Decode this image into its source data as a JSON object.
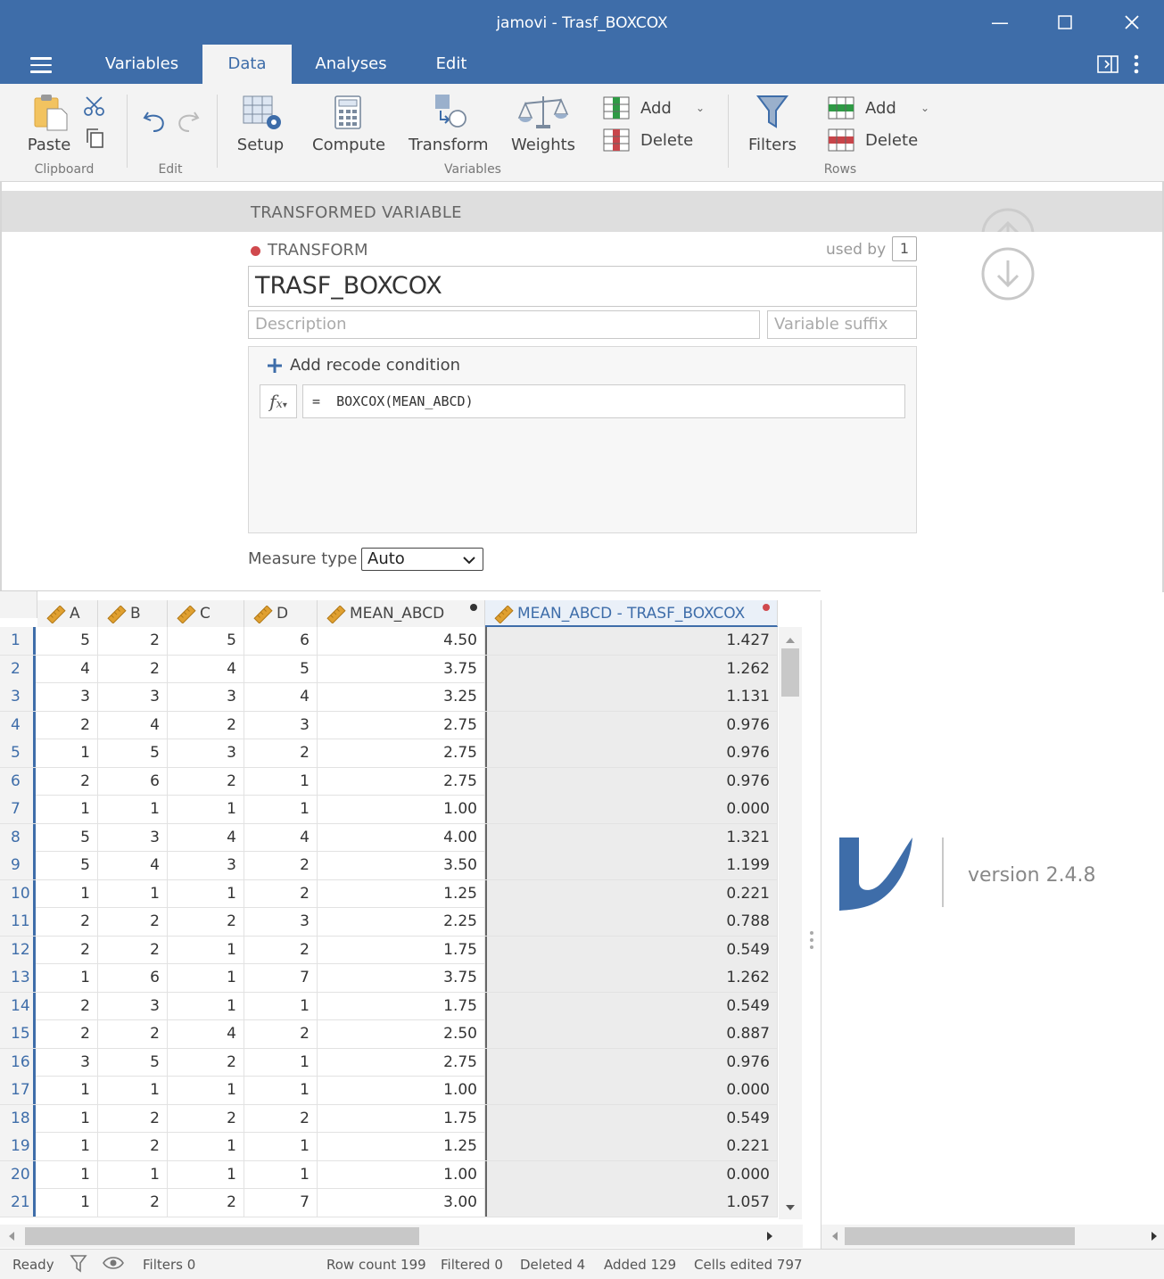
{
  "window": {
    "title": "jamovi - Trasf_BOXCOX"
  },
  "tabs": [
    {
      "label": "Variables"
    },
    {
      "label": "Data"
    },
    {
      "label": "Analyses"
    },
    {
      "label": "Edit"
    }
  ],
  "ribbon": {
    "paste": "Paste",
    "clipboard_group": "Clipboard",
    "edit_group": "Edit",
    "setup": "Setup",
    "compute": "Compute",
    "transform": "Transform",
    "weights": "Weights",
    "var_add": "Add",
    "var_delete": "Delete",
    "variables_group": "Variables",
    "filters": "Filters",
    "row_add": "Add",
    "row_delete": "Delete",
    "rows_group": "Rows"
  },
  "setup": {
    "header": "TRANSFORMED VARIABLE",
    "transform_label": "TRANSFORM",
    "used_by_label": "used by",
    "used_by_count": "1",
    "name": "TRASF_BOXCOX",
    "description_placeholder": "Description",
    "suffix_placeholder": "Variable suffix",
    "add_recode": "Add recode condition",
    "formula": "=  BOXCOX(MEAN_ABCD)",
    "measure_type_label": "Measure type",
    "measure_type_value": "Auto",
    "measure_type_options": [
      "Auto"
    ]
  },
  "grid": {
    "columns": [
      "A",
      "B",
      "C",
      "D",
      "MEAN_ABCD",
      "MEAN_ABCD - TRASF_BOXCOX"
    ],
    "rows": [
      [
        "1",
        "5",
        "2",
        "5",
        "6",
        "4.50",
        "1.427"
      ],
      [
        "2",
        "4",
        "2",
        "4",
        "5",
        "3.75",
        "1.262"
      ],
      [
        "3",
        "3",
        "3",
        "3",
        "4",
        "3.25",
        "1.131"
      ],
      [
        "4",
        "2",
        "4",
        "2",
        "3",
        "2.75",
        "0.976"
      ],
      [
        "5",
        "1",
        "5",
        "3",
        "2",
        "2.75",
        "0.976"
      ],
      [
        "6",
        "2",
        "6",
        "2",
        "1",
        "2.75",
        "0.976"
      ],
      [
        "7",
        "1",
        "1",
        "1",
        "1",
        "1.00",
        "0.000"
      ],
      [
        "8",
        "5",
        "3",
        "4",
        "4",
        "4.00",
        "1.321"
      ],
      [
        "9",
        "5",
        "4",
        "3",
        "2",
        "3.50",
        "1.199"
      ],
      [
        "10",
        "1",
        "1",
        "1",
        "2",
        "1.25",
        "0.221"
      ],
      [
        "11",
        "2",
        "2",
        "2",
        "3",
        "2.25",
        "0.788"
      ],
      [
        "12",
        "2",
        "2",
        "1",
        "2",
        "1.75",
        "0.549"
      ],
      [
        "13",
        "1",
        "6",
        "1",
        "7",
        "3.75",
        "1.262"
      ],
      [
        "14",
        "2",
        "3",
        "1",
        "1",
        "1.75",
        "0.549"
      ],
      [
        "15",
        "2",
        "2",
        "4",
        "2",
        "2.50",
        "0.887"
      ],
      [
        "16",
        "3",
        "5",
        "2",
        "1",
        "2.75",
        "0.976"
      ],
      [
        "17",
        "1",
        "1",
        "1",
        "1",
        "1.00",
        "0.000"
      ],
      [
        "18",
        "1",
        "2",
        "2",
        "2",
        "1.75",
        "0.549"
      ],
      [
        "19",
        "1",
        "2",
        "1",
        "1",
        "1.25",
        "0.221"
      ],
      [
        "20",
        "1",
        "1",
        "1",
        "1",
        "1.00",
        "0.000"
      ],
      [
        "21",
        "1",
        "2",
        "2",
        "7",
        "3.00",
        "1.057"
      ]
    ]
  },
  "results": {
    "version": "version 2.4.8"
  },
  "status": {
    "ready": "Ready",
    "filters": "Filters 0",
    "row_count": "Row count 199",
    "filtered": "Filtered 0",
    "deleted": "Deleted 4",
    "added": "Added 129",
    "cells_edited": "Cells edited 797"
  },
  "colors": {
    "brand": "#3e6da9",
    "accent_red": "#d0494d",
    "ruler": "#e0a030"
  }
}
